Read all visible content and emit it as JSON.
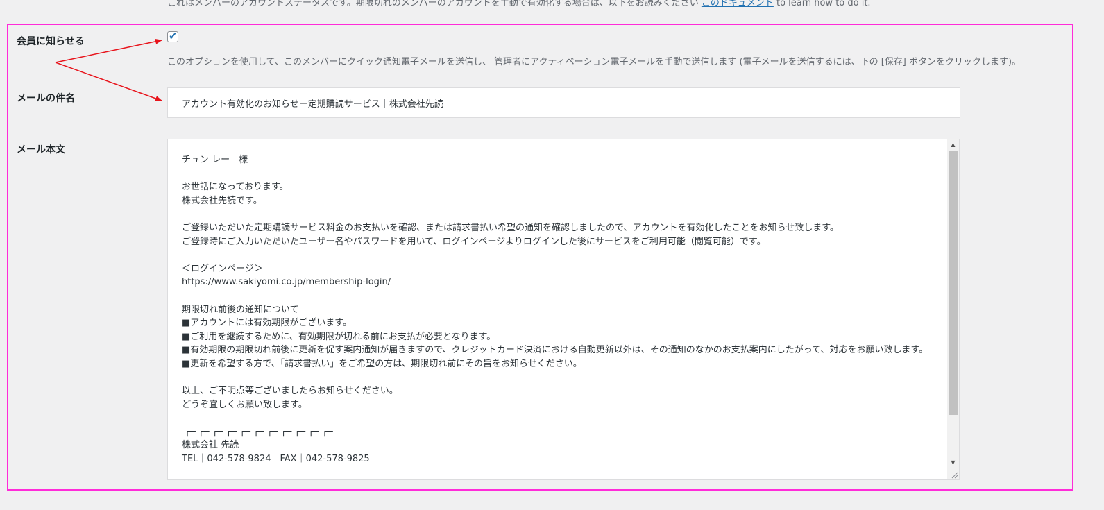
{
  "top_note": {
    "text": "これはメンバーのアカウントステータスです。期限切れのメンバーのアカウントを手動で有効化する場合は、以下をお読みください ",
    "link": "このドキュメント",
    "suffix": " to learn how to do it."
  },
  "notify": {
    "label": "会員に知らせる",
    "checked": true,
    "check_glyph": "✔",
    "description": "このオプションを使用して、このメンバーにクイック通知電子メールを送信し、 管理者にアクティベーション電子メールを手動で送信します (電子メールを送信するには、下の [保存] ボタンをクリックします)。"
  },
  "subject": {
    "label": "メールの件名",
    "value": "アカウント有効化のお知らせ－定期購読サービス｜株式会社先読"
  },
  "body": {
    "label": "メール本文",
    "value": "チュン レー　様\n\nお世話になっております。\n株式会社先読です。\n\nご登録いただいた定期購読サービス料金のお支払いを確認、または請求書払い希望の通知を確認しましたので、アカウントを有効化したことをお知らせ致します。\nご登録時にご入力いただいたユーザー名やパスワードを用いて、ログインページよりログインした後にサービスをご利用可能（閲覧可能）です。\n\n＜ログインページ＞\nhttps://www.sakiyomi.co.jp/membership-login/\n\n期限切れ前後の通知について\n■アカウントには有効期限がございます。\n■ご利用を継続するために、有効期限が切れる前にお支払が必要となります。\n■有効期限の期限切れ前後に更新を促す案内通知が届きますので、クレジットカード決済における自動更新以外は、その通知のなかのお支払案内にしたがって、対応をお願い致します。\n■更新を希望する方で、「請求書払い」をご希望の方は、期限切れ前にその旨をお知らせください。\n\n以上、ご不明点等ございましたらお知らせください。\nどうぞ宜しくお願い致します。\n\n ┌─ ┌─ ┌─ ┌─ ┌─ ┌─ ┌─ ┌─ ┌─ ┌─ ┌─\n株式会社 先読\nTEL｜042-578-9824　FAX｜042-578-9825"
  },
  "scrollbar": {
    "up_icon": "▲",
    "down_icon": "▼"
  },
  "colors": {
    "highlight_border": "#ff2bd9",
    "annotation_arrow": "#e8131b",
    "link": "#2271b1"
  }
}
